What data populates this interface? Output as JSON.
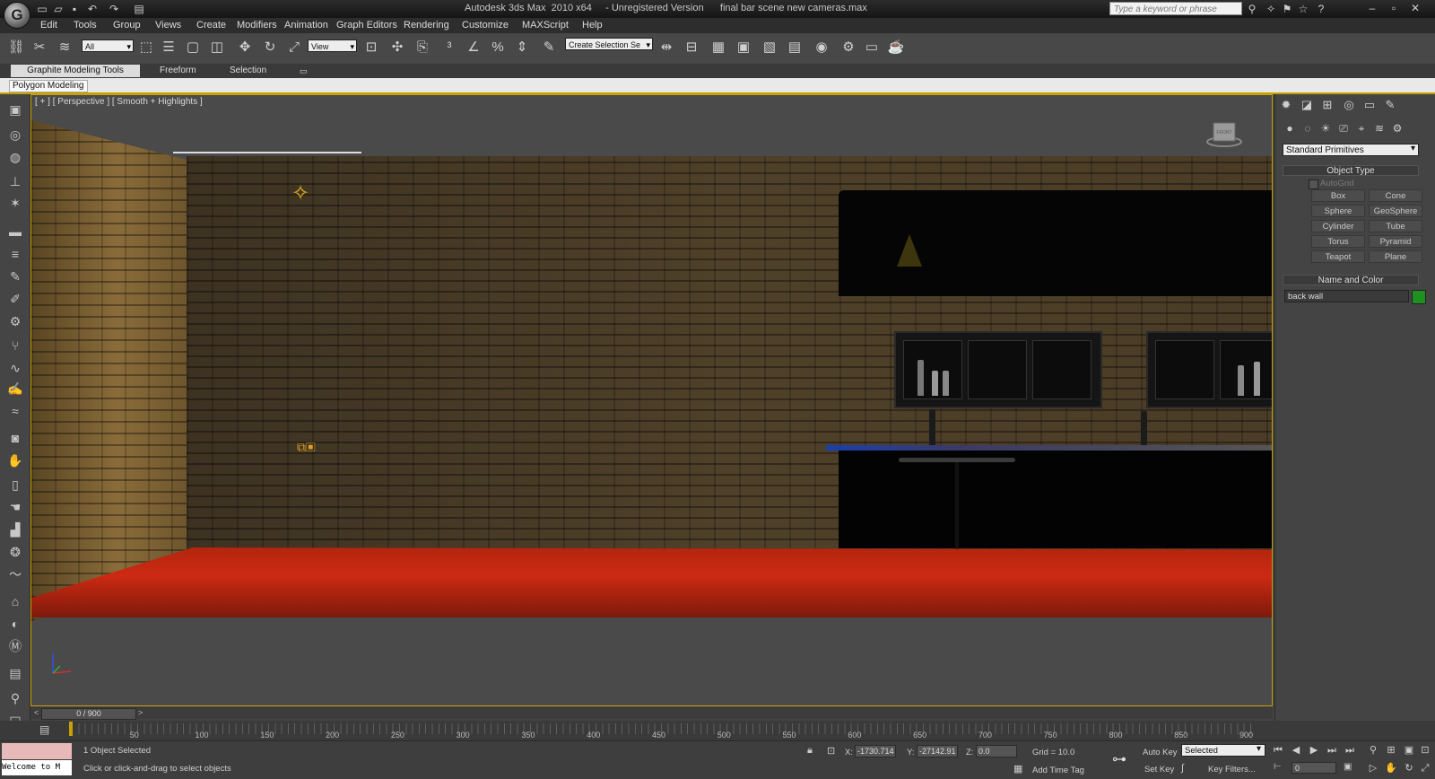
{
  "window": {
    "title": "Autodesk 3ds Max  2010 x64     - Unregistered Version      final bar scene new cameras.max",
    "search_placeholder": "Type a keyword or phrase"
  },
  "menu": [
    "Edit",
    "Tools",
    "Group",
    "Views",
    "Create",
    "Modifiers",
    "Animation",
    "Graph Editors",
    "Rendering",
    "Customize",
    "MAXScript",
    "Help"
  ],
  "toolbar": {
    "selection_filter": "All",
    "reference_coord": "View",
    "named_selection_set": "Create Selection Se"
  },
  "ribbon": {
    "tabs": [
      "Graphite Modeling Tools",
      "Freeform",
      "Selection"
    ],
    "panel_label": "Polygon Modeling"
  },
  "viewport": {
    "label": "[ + ] [ Perspective ] [ Smooth + Highlights ]",
    "viewcube_face": "FRONT"
  },
  "command_panel": {
    "category": "Standard Primitives",
    "object_type_title": "Object Type",
    "autogrid_label": "AutoGrid",
    "primitives": [
      "Box",
      "Cone",
      "Sphere",
      "GeoSphere",
      "Cylinder",
      "Tube",
      "Torus",
      "Pyramid",
      "Teapot",
      "Plane"
    ],
    "name_color_title": "Name and Color",
    "object_name": "back wall",
    "object_color": "#1f8f1f"
  },
  "timeline": {
    "slider": "0 / 900",
    "ticks": [
      "50",
      "100",
      "150",
      "200",
      "250",
      "300",
      "350",
      "400",
      "450",
      "500",
      "550",
      "600",
      "650",
      "700",
      "750",
      "800",
      "850",
      "900"
    ]
  },
  "status": {
    "maxscript_text": "Welcome to M",
    "selection_status": "1 Object Selected",
    "prompt": "Click or click-and-drag to select objects",
    "x_label": "X:",
    "x_value": "-1730.714",
    "y_label": "Y:",
    "y_value": "-27142.91",
    "z_label": "Z:",
    "z_value": "0.0",
    "grid": "Grid = 10.0",
    "add_time_tag": "Add Time Tag",
    "auto_key": "Auto Key",
    "auto_key_mode": "Selected",
    "set_key": "Set Key",
    "key_filters": "Key Filters...",
    "current_frame": "0"
  }
}
